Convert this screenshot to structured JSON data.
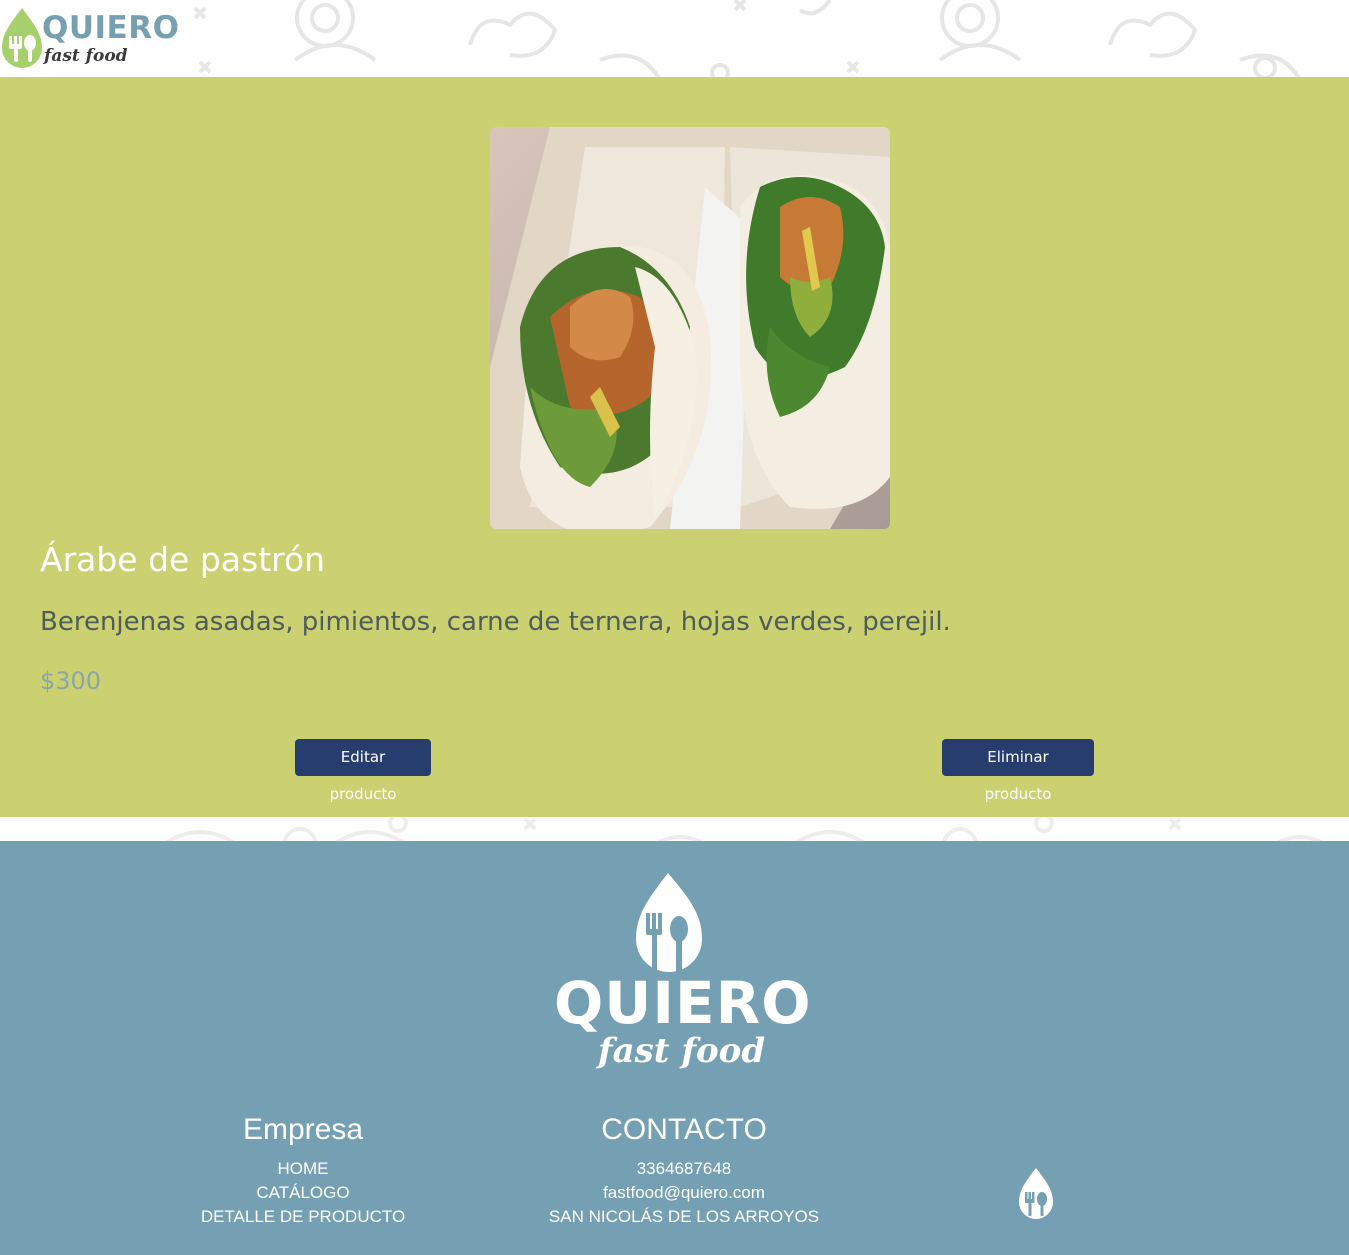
{
  "header": {
    "logo_word": "QUIERO",
    "logo_sub": "fast food"
  },
  "product": {
    "image_alt": "bao-sandwiches-photo",
    "title": "Árabe de pastrón",
    "description": "Berenjenas asadas, pimientos, carne de ternera, hojas verdes, perejil.",
    "price": "$300",
    "edit_label": "Editar producto",
    "delete_label": "Eliminar producto"
  },
  "footer": {
    "logo_word": "QUIERO",
    "logo_sub": "fast food",
    "empresa": {
      "heading": "Empresa",
      "links": [
        "HOME",
        "CATÁLOGO",
        "DETALLE DE PRODUCTO"
      ]
    },
    "contacto": {
      "heading": "CONTACTO",
      "items": [
        "3364687648",
        "fastfood@quiero.com",
        "SAN NICOLÁS DE LOS ARROYOS"
      ]
    }
  },
  "colors": {
    "product_bg": "#cbd171",
    "footer_bg": "#759fb3",
    "button_bg": "#263d6e",
    "logo_green": "#a6d06c",
    "logo_blue": "#76a0b2"
  },
  "icons": [
    "logo-drop-icon",
    "fork-icon",
    "spoon-icon",
    "doodle-pattern"
  ]
}
